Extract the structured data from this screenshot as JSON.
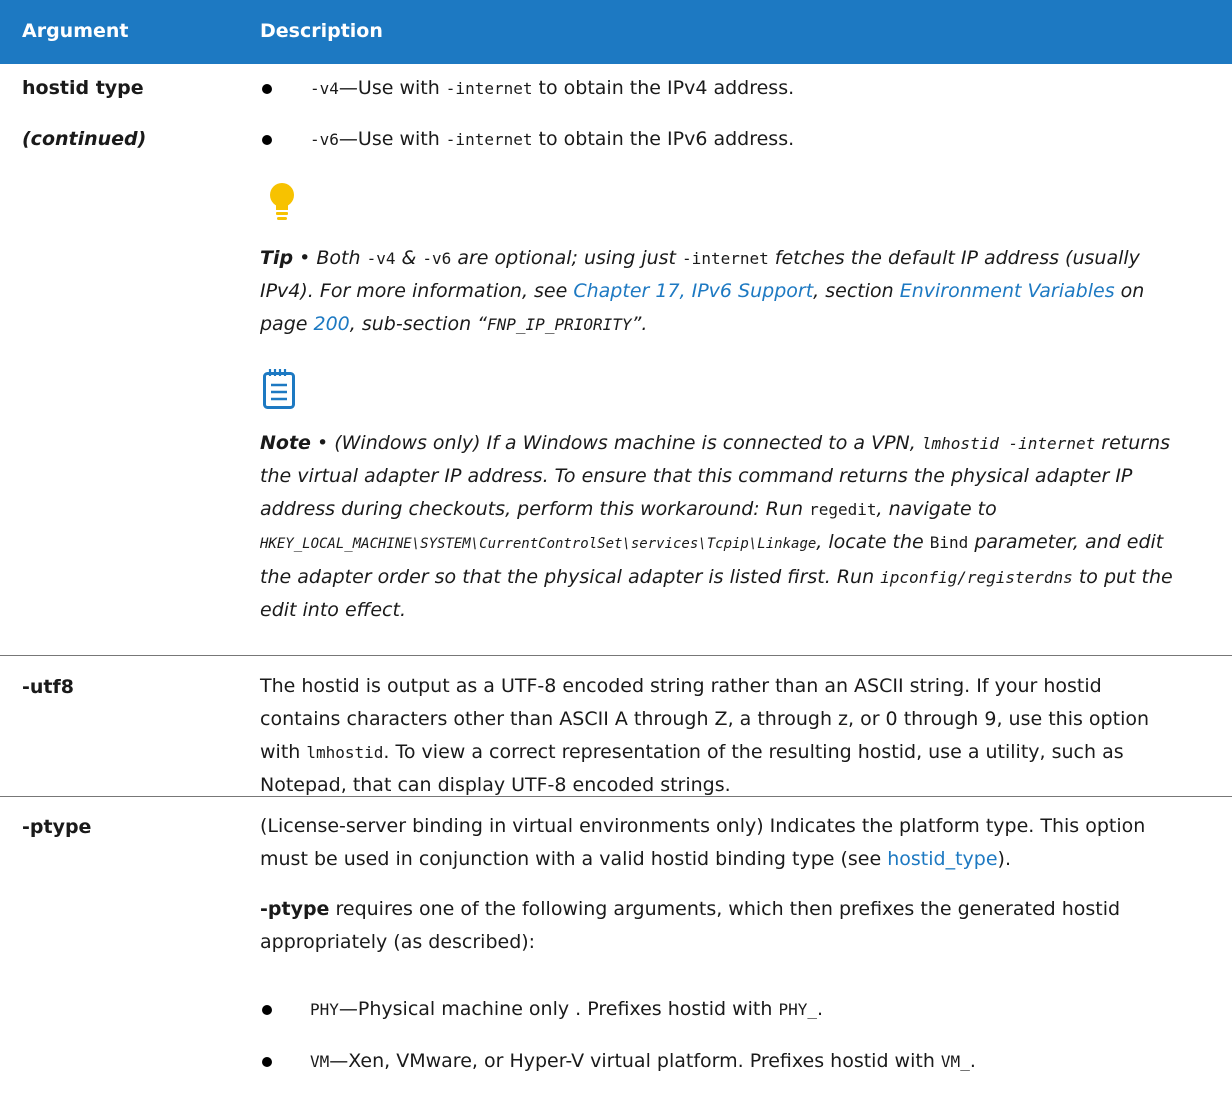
{
  "header": {
    "col1": "Argument",
    "col2": "Description"
  },
  "colors": {
    "header_bg": "#1d79c2",
    "link": "#1d79c2",
    "tip_bulb": "#f7c200",
    "note_icon": "#1d79c2"
  },
  "icons": [
    "lightbulb-icon",
    "notepad-icon"
  ],
  "row1": {
    "arg": "hostid type",
    "arg_cont": "(continued)",
    "bullets": [
      {
        "code": "-v4",
        "text": "—Use with ",
        "code2": "-internet",
        "text2": " to obtain the IPv4 address."
      },
      {
        "code": "-v6",
        "text": "—Use with ",
        "code2": "-internet",
        "text2": " to obtain the IPv6 address."
      }
    ],
    "tip": {
      "label": "Tip",
      "sep": " • ",
      "t1": "Both ",
      "c1": "-v4",
      "t2": " & ",
      "c2": "-v6",
      "t3": " are optional; using just ",
      "c3": "-internet",
      "t4": " fetches the default IP address (usually IPv4). For more information, see ",
      "link1": "Chapter 17, IPv6 Support",
      "t5": ", section ",
      "link2": "Environment Variables",
      "t6": " on page ",
      "link3": "200",
      "t7": ", sub-section “",
      "c4": "FNP_IP_PRIORITY",
      "t8": "”."
    },
    "note": {
      "label": "Note",
      "sep": " • ",
      "t1": "(Windows only) If a Windows machine is connected to a VPN, ",
      "c1": "lmhostid -internet",
      "t2": " returns the virtual adapter IP address. To ensure that this command returns the physical adapter IP address during checkouts, perform this workaround: Run ",
      "c2": "regedit",
      "t3": ", navigate to ",
      "c3": "HKEY_LOCAL_MACHINE\\SYSTEM\\CurrentControlSet\\services\\Tcpip\\Linkage",
      "t4": ", locate the ",
      "c4": "Bind",
      "t5": " parameter, and edit the adapter order so that the physical adapter is listed first. Run ",
      "c5": "ipconfig/registerdns",
      "t6": " to put the edit into effect."
    }
  },
  "row2": {
    "arg": "-utf8",
    "t1": "The hostid is output as a UTF-8 encoded string rather than an ASCII string. If your hostid contains characters other than ASCII A through Z, a through z, or 0 through 9, use this option with ",
    "c1": "lmhostid",
    "t2": ". To view a correct representation of the resulting hostid, use a utility, such as Notepad, that can display UTF-8 encoded strings."
  },
  "row3": {
    "arg": "-ptype",
    "p1": "(License-server binding in virtual environments only) Indicates the platform type. This option must be used in conjunction with a valid hostid binding type (see ",
    "p1_link": "hostid_type",
    "p1_end": ").",
    "p2_bold": "-ptype",
    "p2": " requires one of the following arguments, which then prefixes the generated hostid appropriately (as described):",
    "bullets": [
      {
        "code": "PHY",
        "text": "—Physical machine only . Prefixes hostid with ",
        "code2": "PHY_",
        "text2": "."
      },
      {
        "code": "VM",
        "text": "—Xen, VMware, or Hyper-V virtual platform. Prefixes hostid with ",
        "code2": "VM_",
        "text2": "."
      }
    ]
  }
}
